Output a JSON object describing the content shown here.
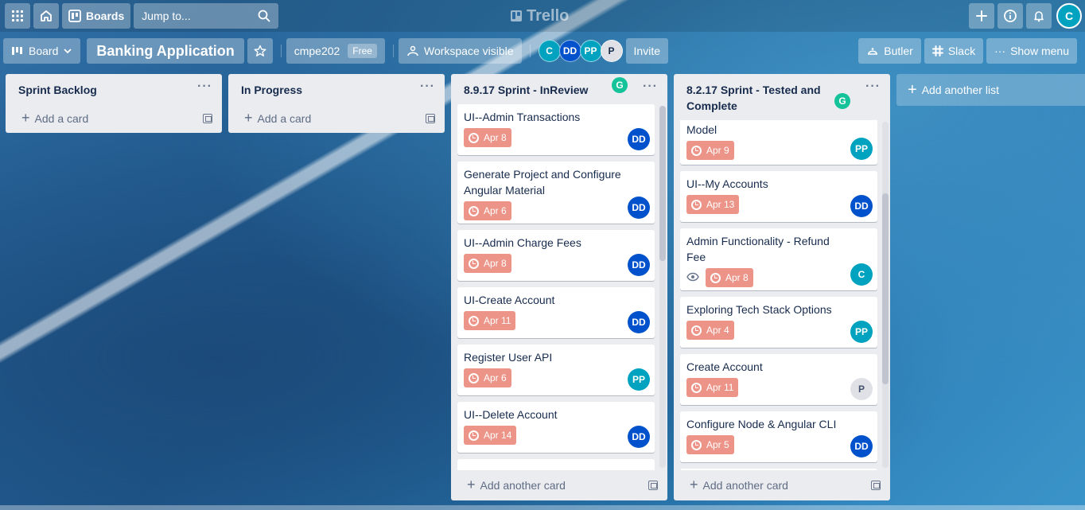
{
  "header": {
    "boards_label": "Boards",
    "search_placeholder": "Jump to...",
    "logo_text": "Trello",
    "user_avatar": "C"
  },
  "board": {
    "view_label": "Board",
    "title": "Banking Application",
    "workspace_name": "cmpe202",
    "workspace_plan": "Free",
    "visibility_label": "Workspace visible",
    "members": [
      {
        "initials": "C",
        "color": "#00a3bf"
      },
      {
        "initials": "DD",
        "color": "#0052cc"
      },
      {
        "initials": "PP",
        "color": "#00a3bf"
      },
      {
        "initials": "P",
        "color": "#dfe1e6"
      }
    ],
    "invite_label": "Invite",
    "butler_label": "Butler",
    "slack_label": "Slack",
    "menu_label": "Show menu"
  },
  "lists": [
    {
      "title": "Sprint Backlog",
      "footer": "Add a card",
      "cards": []
    },
    {
      "title": "In Progress",
      "footer": "Add a card",
      "cards": []
    },
    {
      "title": "8.9.17 Sprint - InReview",
      "footer": "Add another card",
      "cards": [
        {
          "title": "UI--Admin Transactions",
          "due": "Apr 8",
          "member": "DD"
        },
        {
          "title": "Generate Project and Configure Angular Material",
          "due": "Apr 6",
          "member": "DD"
        },
        {
          "title": "UI--Admin Charge Fees",
          "due": "Apr 8",
          "member": "DD"
        },
        {
          "title": "UI-Create Account",
          "due": "Apr 11",
          "member": "DD"
        },
        {
          "title": "Register User API",
          "due": "Apr 6",
          "member": "PP"
        },
        {
          "title": "UI--Delete Account",
          "due": "Apr 14",
          "member": "DD"
        }
      ]
    },
    {
      "title": "8.2.17 Sprint - Tested and Complete",
      "footer": "Add another card",
      "cards": [
        {
          "title": "Model",
          "due": "Apr 9",
          "member": "PP"
        },
        {
          "title": "UI--My Accounts",
          "due": "Apr 13",
          "member": "DD"
        },
        {
          "title": "Admin Functionality - Refund Fee",
          "due": "Apr 8",
          "member": "C"
        },
        {
          "title": "Exploring Tech Stack Options",
          "due": "Apr 4",
          "member": "PP"
        },
        {
          "title": "Create Account",
          "due": "Apr 11",
          "member": "P"
        },
        {
          "title": "Configure Node & Angular CLI",
          "due": "Apr 5",
          "member": "DD"
        }
      ]
    }
  ],
  "add_list_label": "Add another list",
  "colors": {
    "due_badge": "#ec9488",
    "member_dd": "#0052cc",
    "member_pp": "#00a3bf",
    "member_c": "#00a3bf",
    "member_p": "#dfe1e6",
    "grammarly": "#15c39a"
  }
}
